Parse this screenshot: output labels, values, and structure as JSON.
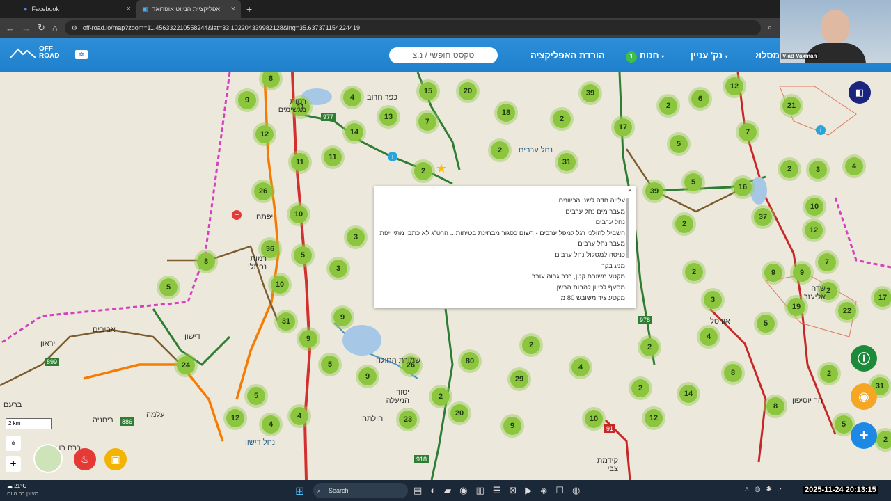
{
  "tabs": [
    {
      "label": "Facebook"
    },
    {
      "label": "אפליקציית הניווט אופרואד",
      "active": true
    }
  ],
  "url": "off-road.io/map?zoom=11.456332210558244&lat=33.102204339982128&lng=35.637371154224419",
  "app": {
    "logo": "OFF ROAD",
    "search_placeholder": "טקסט חופשי / נ.צ",
    "menu": {
      "download": "הורדת האפליקציה",
      "stores": "חנות",
      "stores_badge": "1",
      "poi": "נק' עניין",
      "routes": "מסלולים"
    }
  },
  "webcam_name": "Vlad Vaxman",
  "scale": "2 km",
  "popup_items": [
    "עלייה חדה לשני הכיוונים",
    "מעבר מים נחל ערבים",
    "נחל ערבים",
    "השביל להולכי רגל למפל ערבים - רשום כסגור מבחינת בטיחות... הרט\"ג לא כתבו מתי ייפתח",
    "מעבר נחל ערבים",
    "כניסה למסלול נחל ערבים",
    "מנע בקר",
    "מקטע משובח קטן, רכב גבוה עובר",
    "מסעף לכיוון להבות הבשן",
    "מקטע ציר משובש 80 מ"
  ],
  "clusters": [
    {
      "v": "8"
    },
    {
      "v": "9"
    },
    {
      "v": "11"
    },
    {
      "v": "12"
    },
    {
      "v": "4"
    },
    {
      "v": "14"
    },
    {
      "v": "13"
    },
    {
      "v": "11"
    },
    {
      "v": "7"
    },
    {
      "v": "15"
    },
    {
      "v": "20"
    },
    {
      "v": "18"
    },
    {
      "v": "2"
    },
    {
      "v": "39"
    },
    {
      "v": "2"
    },
    {
      "v": "31"
    },
    {
      "v": "2"
    },
    {
      "v": "11"
    },
    {
      "v": "26"
    },
    {
      "v": "10"
    },
    {
      "v": "3"
    },
    {
      "v": "36"
    },
    {
      "v": "5"
    },
    {
      "v": "8"
    },
    {
      "v": "3"
    },
    {
      "v": "5"
    },
    {
      "v": "10"
    },
    {
      "v": "31"
    },
    {
      "v": "9"
    },
    {
      "v": "9"
    },
    {
      "v": "24"
    },
    {
      "v": "5"
    },
    {
      "v": "9"
    },
    {
      "v": "26"
    },
    {
      "v": "5"
    },
    {
      "v": "12"
    },
    {
      "v": "4"
    },
    {
      "v": "4"
    },
    {
      "v": "80"
    },
    {
      "v": "2"
    },
    {
      "v": "20"
    },
    {
      "v": "23"
    },
    {
      "v": "2"
    },
    {
      "v": "29"
    },
    {
      "v": "4"
    },
    {
      "v": "9"
    },
    {
      "v": "10"
    },
    {
      "v": "12"
    },
    {
      "v": "2"
    },
    {
      "v": "14"
    },
    {
      "v": "12"
    },
    {
      "v": "21"
    },
    {
      "v": "6"
    },
    {
      "v": "2"
    },
    {
      "v": "17"
    },
    {
      "v": "5"
    },
    {
      "v": "7"
    },
    {
      "v": "2"
    },
    {
      "v": "3"
    },
    {
      "v": "4"
    },
    {
      "v": "39"
    },
    {
      "v": "5"
    },
    {
      "v": "16"
    },
    {
      "v": "37"
    },
    {
      "v": "10"
    },
    {
      "v": "2"
    },
    {
      "v": "12"
    },
    {
      "v": "7"
    },
    {
      "v": "2"
    },
    {
      "v": "9"
    },
    {
      "v": "9"
    },
    {
      "v": "3"
    },
    {
      "v": "2"
    },
    {
      "v": "19"
    },
    {
      "v": "22"
    },
    {
      "v": "17"
    },
    {
      "v": "4"
    },
    {
      "v": "5"
    },
    {
      "v": "2"
    },
    {
      "v": "8"
    },
    {
      "v": "2"
    },
    {
      "v": "31"
    },
    {
      "v": "8"
    },
    {
      "v": "5"
    },
    {
      "v": "2"
    }
  ],
  "places": [
    "כפר חרוב",
    "רמות מגשימים",
    "יפתח",
    "רמות נפתלי",
    "דישון",
    "אביבים",
    "יראון",
    "ברעם",
    "עלמה",
    "ריחניה",
    "כרם בן זמרה",
    "יסוד המעלה",
    "שדה אליעזר",
    "אורטל",
    "קידמת צבי",
    "חולתה",
    "הר יוסיפון",
    "נחל ערבים",
    "נחל דישון",
    "שמורת החולה"
  ],
  "road_numbers": [
    "977",
    "899",
    "886",
    "918",
    "978",
    "91"
  ],
  "taskbar": {
    "temp": "21°C",
    "weather": "מעונן רב היום",
    "search": "Search",
    "datetime": "2025-11-24 20:13:15"
  }
}
